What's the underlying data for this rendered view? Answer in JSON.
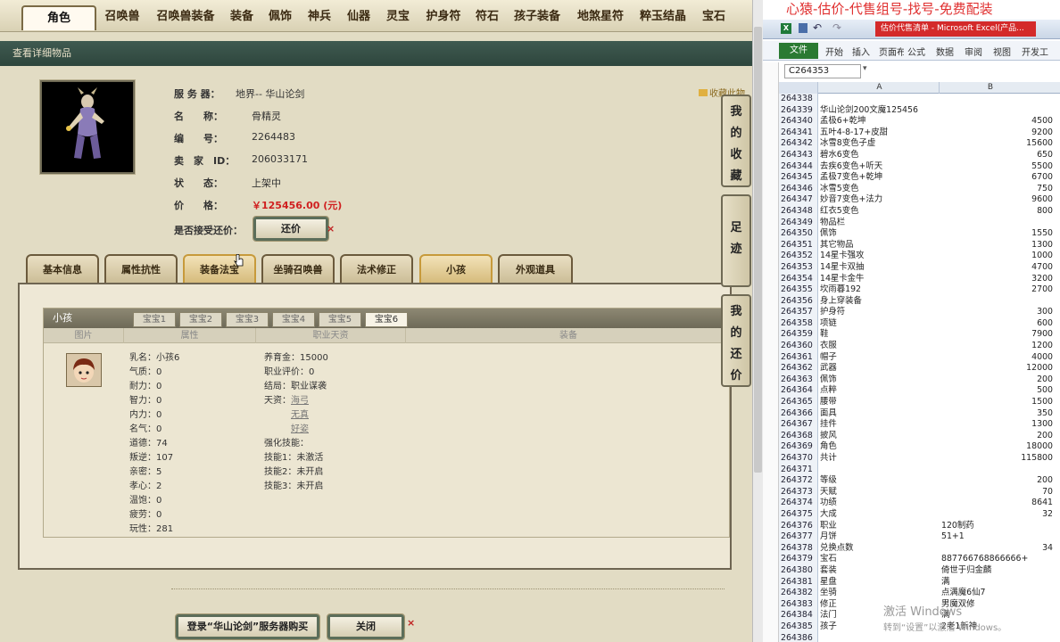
{
  "top_tabs": [
    "角色",
    "召唤兽",
    "召唤兽装备",
    "装备",
    "佩饰",
    "神兵",
    "仙器",
    "灵宝",
    "护身符",
    "符石",
    "孩子装备",
    "地煞星符",
    "粹玉结晶",
    "宝石"
  ],
  "panel_title": "查看详细物品",
  "collect_link": "收藏此物",
  "info": {
    "server_label": "服 务 器：",
    "server_value": "地界-- 华山论剑",
    "name_label": "名　　称：",
    "name_value": "骨精灵",
    "id_label": "编　　号：",
    "id_value": "2264483",
    "seller_label": "卖　家　ID：",
    "seller_value": "206033171",
    "status_label": "状　　态：",
    "status_value": "上架中",
    "price_label": "价　　格：",
    "price_value": "￥125456.00 (元)",
    "bargain_label": "是否接受还价：",
    "bargain_button": "还价"
  },
  "sub_tabs": [
    "基本信息",
    "属性抗性",
    "装备法宝",
    "坐骑召唤兽",
    "法术修正",
    "小孩",
    "外观道具"
  ],
  "child_section_title": "小孩",
  "baby_tabs": [
    "宝宝1",
    "宝宝2",
    "宝宝3",
    "宝宝4",
    "宝宝5",
    "宝宝6"
  ],
  "col_headers": [
    "图片",
    "属性",
    "职业天资",
    "装备"
  ],
  "child_attrs": [
    "乳名：小孩6",
    "气质：0",
    "耐力：0",
    "智力：0",
    "内力：0",
    "名气：0",
    "道德：74",
    "叛逆：107",
    "亲密：5",
    "孝心：2",
    "温饱：0",
    "疲劳：0",
    "玩性：281"
  ],
  "child_career": {
    "fund": "养育金：15000",
    "rating": "职业评价：0",
    "ending": "结局：职业谋袭",
    "talent_label": "天资：",
    "talents": [
      "海弓",
      "无真",
      "好姿"
    ],
    "skill_label": "强化技能：",
    "skills": [
      "技能1：未激活",
      "技能2：未开启",
      "技能3：未开启"
    ]
  },
  "side_tabs": [
    "我的收藏",
    "足迹",
    "我的还价"
  ],
  "bottom_buttons": {
    "buy": "登录“华山论剑”服务器购买",
    "close": "关闭"
  },
  "excel": {
    "banner": "心猿-估价-代售组号-找号-免费配装",
    "window_title": "估价代售清单 - Microsoft Excel(产品...",
    "ribbon": [
      "文件",
      "开始",
      "插入",
      "页面布局",
      "公式",
      "数据",
      "审阅",
      "视图",
      "开发工"
    ],
    "name_box": "C264353",
    "col_a": "A",
    "col_b": "B",
    "rows": [
      [
        "264338",
        "",
        ""
      ],
      [
        "264339",
        "华山论剑200文魔125456",
        ""
      ],
      [
        "264340",
        "孟极6+乾坤",
        "4500"
      ],
      [
        "264341",
        "五叶4-8-17+皮甜",
        "9200"
      ],
      [
        "264342",
        "冰雪8变色子虚",
        "15600"
      ],
      [
        "264343",
        "碧水6变色",
        "650"
      ],
      [
        "264344",
        "去疾6变色+听天",
        "5500"
      ],
      [
        "264345",
        "孟极7变色+乾坤",
        "6700"
      ],
      [
        "264346",
        "冰雪5变色",
        "750"
      ],
      [
        "264347",
        "妙音7变色+法力",
        "9600"
      ],
      [
        "264348",
        "红衣5变色",
        "800"
      ],
      [
        "264349",
        "物品栏",
        ""
      ],
      [
        "264350",
        "佩饰",
        "1550"
      ],
      [
        "264351",
        "其它物品",
        "1300"
      ],
      [
        "264352",
        "14星卡强攻",
        "1000"
      ],
      [
        "264353",
        "14星卡双抽",
        "4700"
      ],
      [
        "264354",
        "14星卡金牛",
        "3200"
      ],
      [
        "264355",
        "坎雨暮192",
        "2700"
      ],
      [
        "264356",
        "身上穿装备",
        ""
      ],
      [
        "264357",
        "护身符",
        "300"
      ],
      [
        "264358",
        "项链",
        "600"
      ],
      [
        "264359",
        "鞋",
        "7900"
      ],
      [
        "264360",
        "衣服",
        "1200"
      ],
      [
        "264361",
        "帽子",
        "4000"
      ],
      [
        "264362",
        "武器",
        "12000"
      ],
      [
        "264363",
        "佩饰",
        "200"
      ],
      [
        "264364",
        "点粹",
        "500"
      ],
      [
        "264365",
        "腰带",
        "1500"
      ],
      [
        "264366",
        "面具",
        "350"
      ],
      [
        "264367",
        "挂件",
        "1300"
      ],
      [
        "264368",
        "披风",
        "200"
      ],
      [
        "264369",
        "角色",
        "18000"
      ],
      [
        "264370",
        "共计",
        "115800"
      ],
      [
        "264371",
        "",
        ""
      ],
      [
        "264372",
        "等级",
        "200"
      ],
      [
        "264373",
        "天赋",
        "70"
      ],
      [
        "264374",
        "功绩",
        "8641"
      ],
      [
        "264375",
        "大成",
        "32"
      ],
      [
        "264376",
        "职业",
        "120制药"
      ],
      [
        "264377",
        "月饼",
        "51+1"
      ],
      [
        "264378",
        "兑换点数",
        "34"
      ],
      [
        "264379",
        "宝石",
        "887766768866666+"
      ],
      [
        "264380",
        "套装",
        "倚世于归金麟"
      ],
      [
        "264381",
        "星盘",
        "满"
      ],
      [
        "264382",
        "坐骑",
        "点满魔6仙7"
      ],
      [
        "264383",
        "修正",
        "男魔双修"
      ],
      [
        "264384",
        "法门",
        "满"
      ],
      [
        "264385",
        "孩子",
        "2老1新神"
      ],
      [
        "264386",
        "",
        ""
      ]
    ],
    "watermark_line1": "激活 Windows",
    "watermark_line2": "转到“设置”以激活 Windows。"
  }
}
